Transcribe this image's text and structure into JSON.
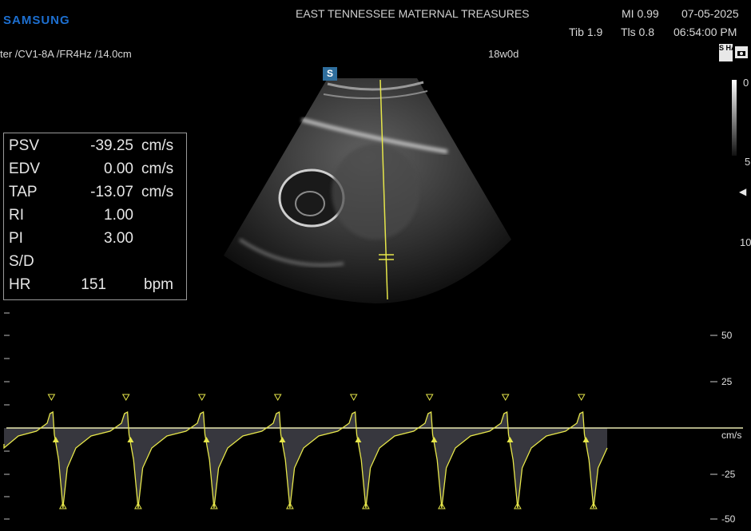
{
  "header": {
    "brand": "SAMSUNG",
    "facility": "EAST TENNESSEE MATERNAL TREASURES",
    "mi": "MI  0.99",
    "date": "07-05-2025",
    "tib": "Tib 1.9",
    "tis": "Tls 0.8",
    "time": "06:54:00 PM"
  },
  "probe_info": "ter /CV1-8A /FR4Hz /14.0cm",
  "gestational_age": "18w0d",
  "badges": {
    "s_badge": "S",
    "har_badge": "S HAR",
    "camera_icon": "camera-icon"
  },
  "depth_scale": {
    "top": "0",
    "mid": "5",
    "bottom": "10"
  },
  "measurements": [
    {
      "label": "PSV",
      "value": "-39.25",
      "unit": "cm/s"
    },
    {
      "label": "EDV",
      "value": "0.00",
      "unit": "cm/s"
    },
    {
      "label": "TAP",
      "value": "-13.07",
      "unit": "cm/s"
    },
    {
      "label": "RI",
      "value": "1.00",
      "unit": ""
    },
    {
      "label": "PI",
      "value": "3.00",
      "unit": ""
    },
    {
      "label": "S/D",
      "value": "",
      "unit": ""
    },
    {
      "label": "HR",
      "value": "151",
      "unit": "bpm"
    }
  ],
  "doppler": {
    "unit": "cm/s",
    "ticks": [
      "50",
      "25",
      "-25",
      "-50"
    ],
    "baseline_color": "#e8e8b0",
    "trace_color": "#e6e64a",
    "cycles": 8
  },
  "colors": {
    "brand": "#1d6fd0",
    "cursor_line": "#e6e64a"
  }
}
